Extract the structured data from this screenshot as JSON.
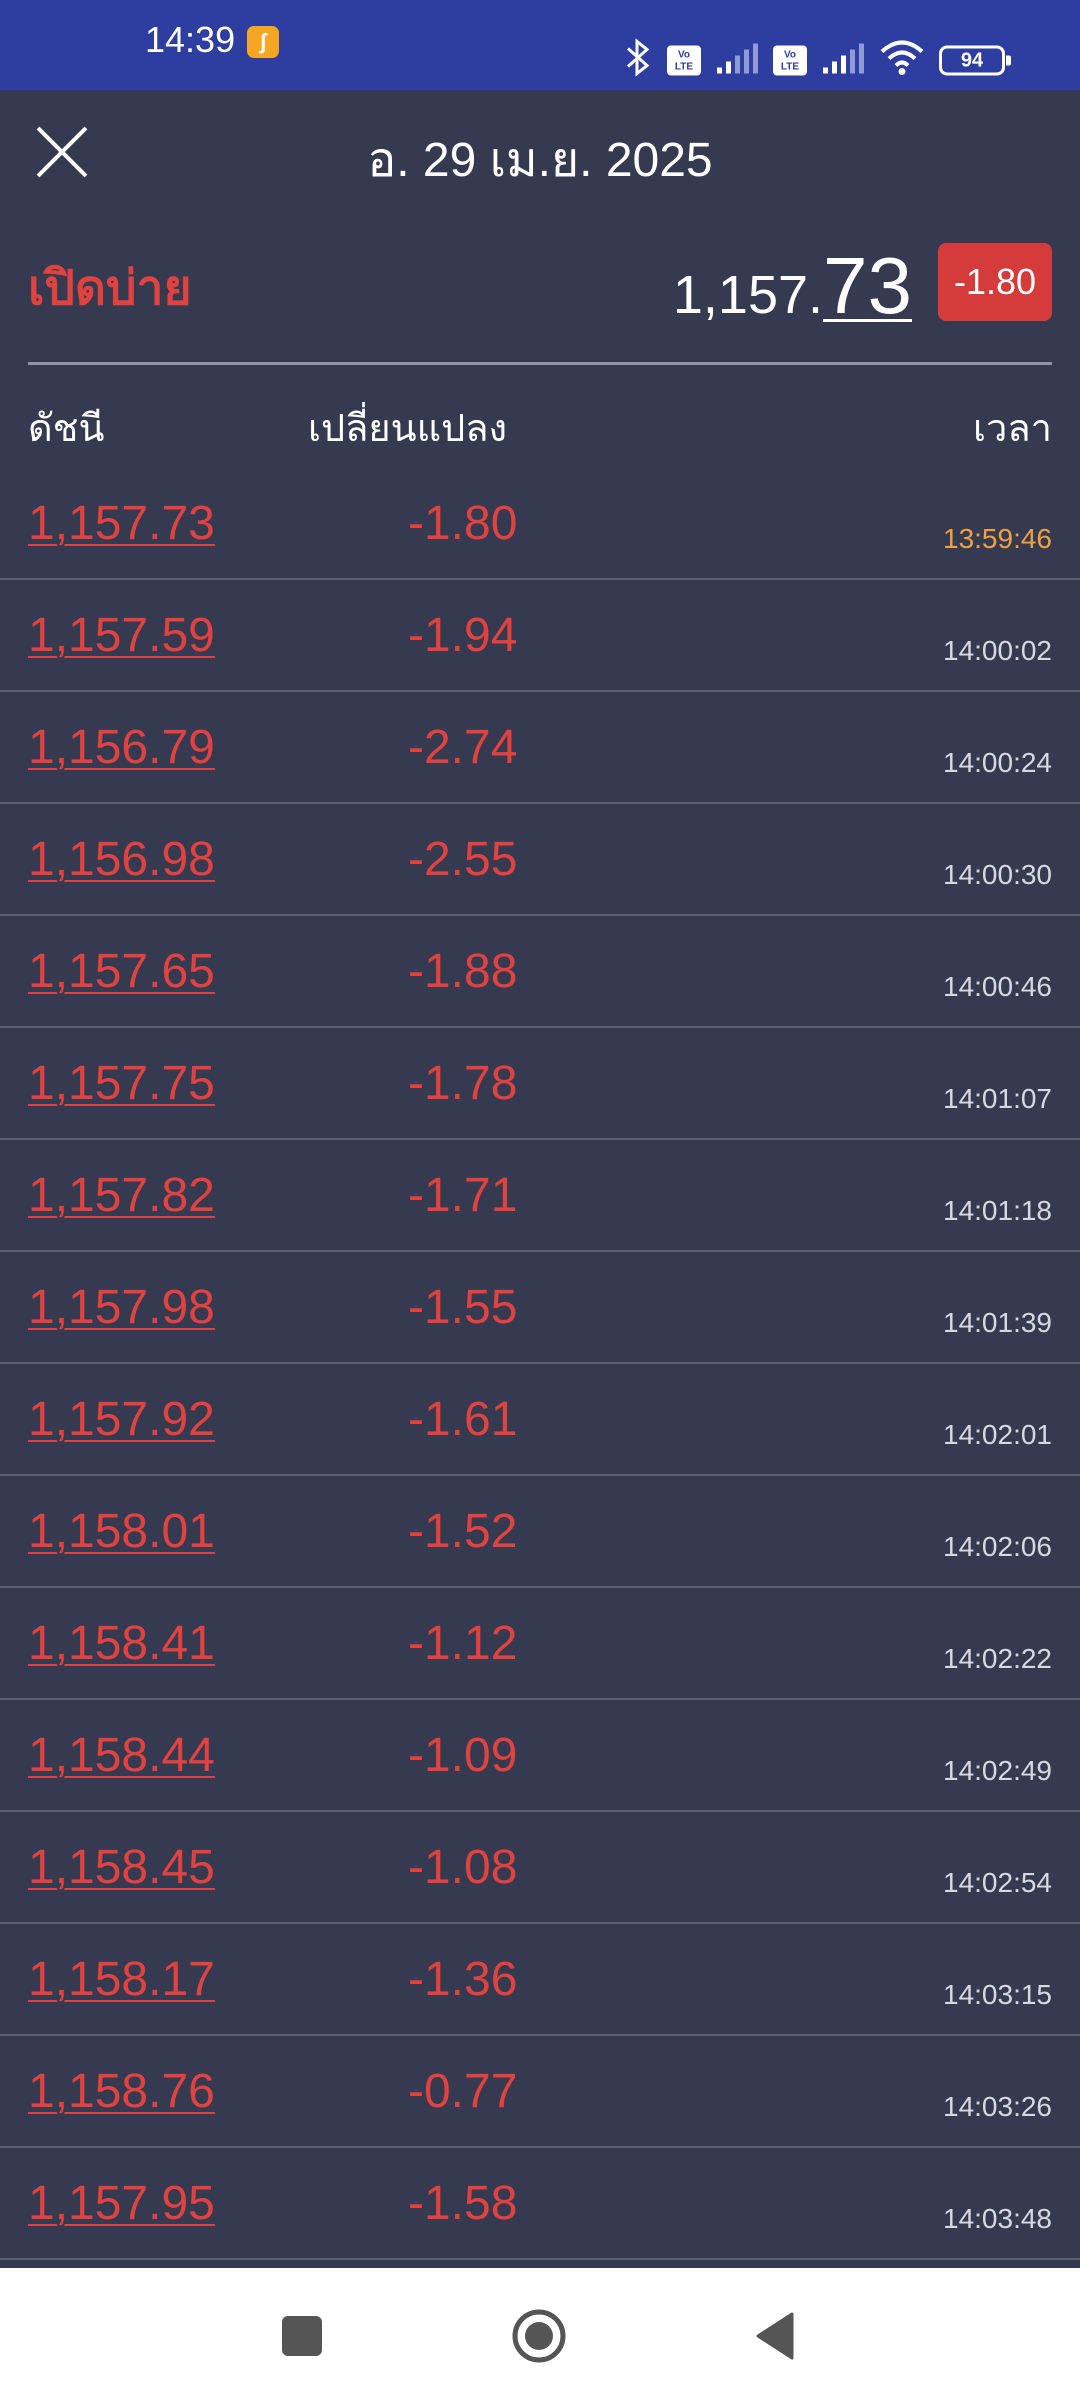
{
  "status_bar": {
    "time": "14:39",
    "battery": "94",
    "volte1": "Vo LTE",
    "volte2": "Vo LTE"
  },
  "header": {
    "title": "อ. 29 เม.ย. 2025"
  },
  "summary": {
    "label": "เปิดบ่าย",
    "value_int": "1,157.",
    "value_dec": "73",
    "change": "-1.80"
  },
  "columns": {
    "index": "ดัชนี",
    "change": "เปลี่ยนแปลง",
    "time": "เวลา"
  },
  "rows": [
    {
      "index": "1,157.73",
      "change": "-1.80",
      "time": "13:59:46"
    },
    {
      "index": "1,157.59",
      "change": "-1.94",
      "time": "14:00:02"
    },
    {
      "index": "1,156.79",
      "change": "-2.74",
      "time": "14:00:24"
    },
    {
      "index": "1,156.98",
      "change": "-2.55",
      "time": "14:00:30"
    },
    {
      "index": "1,157.65",
      "change": "-1.88",
      "time": "14:00:46"
    },
    {
      "index": "1,157.75",
      "change": "-1.78",
      "time": "14:01:07"
    },
    {
      "index": "1,157.82",
      "change": "-1.71",
      "time": "14:01:18"
    },
    {
      "index": "1,157.98",
      "change": "-1.55",
      "time": "14:01:39"
    },
    {
      "index": "1,157.92",
      "change": "-1.61",
      "time": "14:02:01"
    },
    {
      "index": "1,158.01",
      "change": "-1.52",
      "time": "14:02:06"
    },
    {
      "index": "1,158.41",
      "change": "-1.12",
      "time": "14:02:22"
    },
    {
      "index": "1,158.44",
      "change": "-1.09",
      "time": "14:02:49"
    },
    {
      "index": "1,158.45",
      "change": "-1.08",
      "time": "14:02:54"
    },
    {
      "index": "1,158.17",
      "change": "-1.36",
      "time": "14:03:15"
    },
    {
      "index": "1,158.76",
      "change": "-0.77",
      "time": "14:03:26"
    },
    {
      "index": "1,157.95",
      "change": "-1.58",
      "time": "14:03:48"
    }
  ],
  "colors": {
    "background": "#353a50",
    "status_bar": "#2e3da0",
    "negative": "#e0423f",
    "badge": "#d53b3b",
    "first_time": "#f0a040"
  }
}
